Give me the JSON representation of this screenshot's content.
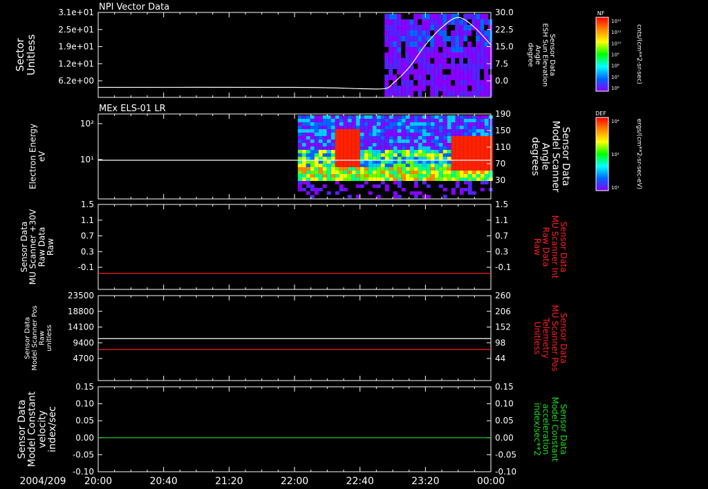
{
  "date_label": "2004/209",
  "time_ticks": [
    "20:00",
    "20:40",
    "21:20",
    "22:00",
    "22:40",
    "23:20",
    "00:00"
  ],
  "colors": {
    "background": "#000000",
    "axes": "#ffffff",
    "red_trace": "#ff2020",
    "green_trace": "#20dd20",
    "white_trace": "#ffffff"
  },
  "colorbars": [
    {
      "title": "NF",
      "unit": "cnts/(cm**2-sr-sec)",
      "tick_labels": [
        "10¹²",
        "10¹¹",
        "10¹⁰",
        "10⁹",
        "10⁸",
        "10⁷",
        "10⁶"
      ],
      "gradient": [
        "#ff0000",
        "#ff8800",
        "#ffff00",
        "#00ff00",
        "#00ffff",
        "#0066ff",
        "#8800ff"
      ]
    },
    {
      "title": "DEF",
      "unit": "ergs/(cm**2-sr-sec-eV)",
      "tick_labels": [
        "10⁴",
        "10²",
        "10¹"
      ],
      "gradient": [
        "#ff0000",
        "#ff8800",
        "#ffff00",
        "#00ff00",
        "#00ffff",
        "#0066ff",
        "#8800ff"
      ]
    }
  ],
  "chart_data": [
    {
      "type": "line",
      "title": "NPI Vector Data",
      "ylabel_left": [
        "Sector",
        "Unitless"
      ],
      "yticks_left": [
        "3.1e+01",
        "2.5e+01",
        "1.9e+01",
        "1.2e+01",
        "6.2e+00"
      ],
      "ylabel_right": [
        "Sensor Data",
        "ESH Sun Elevation",
        "Angle",
        "degree"
      ],
      "yticks_right": [
        "30.0",
        "22.5",
        "15.0",
        "7.5",
        "0.0"
      ],
      "right_range": [
        -4,
        30
      ],
      "series": [
        {
          "axis": "right",
          "color": "#ffffff",
          "points": [
            [
              "20:00",
              0.0
            ],
            [
              "22:00",
              0.0
            ],
            [
              "22:40",
              -0.5
            ],
            [
              "22:55",
              -0.5
            ],
            [
              "23:00",
              1.5
            ],
            [
              "23:10",
              8.0
            ],
            [
              "23:20",
              17.0
            ],
            [
              "23:30",
              24.0
            ],
            [
              "23:40",
              28.0
            ],
            [
              "23:50",
              24.0
            ],
            [
              "24:00",
              17.0
            ]
          ]
        }
      ],
      "spectrogram": {
        "start": "22:55",
        "end": "24:00"
      }
    },
    {
      "type": "line",
      "title": "MEx ELS-01 LR",
      "ylabel_left": [
        "Electron Energy",
        "eV"
      ],
      "yticks_left": [
        "10²",
        "10¹"
      ],
      "ylabel_right": [
        "Sensor Data",
        "Model Scanner",
        "Angle",
        "degrees"
      ],
      "yticks_right": [
        "190",
        "150",
        "110",
        "70",
        "30"
      ],
      "right_range": [
        10,
        190
      ],
      "series": [
        {
          "axis": "right",
          "color": "#ffffff",
          "points": [
            [
              "20:00",
              92
            ],
            [
              "24:00",
              92
            ]
          ]
        }
      ],
      "spectrogram": {
        "start": "22:02",
        "end": "24:00"
      }
    },
    {
      "type": "line",
      "ylabel_left": [
        "Sensor Data",
        "MU Scanner +30V",
        "Raw Data",
        "Raw"
      ],
      "yticks_left": [
        "1.5",
        "1.1",
        "0.7",
        "0.3",
        "-0.1"
      ],
      "ylabel_right": [
        "Sensor Data",
        "MU Scanner Int",
        "Raw Data",
        "Raw"
      ],
      "yticks_right": [
        "1.5",
        "1.1",
        "0.7",
        "0.3",
        "-0.1"
      ],
      "right_range": [
        -0.35,
        1.5
      ],
      "series": [
        {
          "axis": "left",
          "color": "#ff2020",
          "points": [
            [
              "20:00",
              0.0
            ],
            [
              "24:00",
              0.0
            ]
          ]
        }
      ]
    },
    {
      "type": "line",
      "ylabel_left": [
        "Sensor Data",
        "Model Scanner Pos",
        "Raw",
        "unitless"
      ],
      "yticks_left": [
        "23500",
        "18800",
        "14100",
        "9400",
        "4700"
      ],
      "ylabel_right": [
        "Sensor Data",
        "MU Scanner Pos",
        "Telemetry",
        "Unitless"
      ],
      "yticks_right": [
        "260",
        "206",
        "152",
        "98",
        "44"
      ],
      "left_range": [
        0,
        23500
      ],
      "series": [
        {
          "axis": "left",
          "color": "#ffffff",
          "points": [
            [
              "20:00",
              11600
            ],
            [
              "24:00",
              11600
            ]
          ]
        },
        {
          "axis": "left",
          "color": "#ff2020",
          "points": [
            [
              "20:00",
              8600
            ],
            [
              "24:00",
              8600
            ]
          ]
        }
      ]
    },
    {
      "type": "line",
      "ylabel_left": [
        "Sensor Data",
        "Model Constant",
        "velocity",
        "index/sec"
      ],
      "yticks_left": [
        "0.15",
        "0.10",
        "0.05",
        "0.00",
        "-0.05",
        "-0.10"
      ],
      "ylabel_right": [
        "Sensor Data",
        "Model Constant",
        "acceleration",
        "index/sec**2"
      ],
      "yticks_right": [
        "0.15",
        "0.10",
        "0.05",
        "0.00",
        "-0.05",
        "-0.10"
      ],
      "left_range": [
        -0.1,
        0.15
      ],
      "series": [
        {
          "axis": "left",
          "color": "#20dd20",
          "points": [
            [
              "20:00",
              0.0
            ],
            [
              "24:00",
              0.0
            ]
          ]
        }
      ]
    }
  ]
}
